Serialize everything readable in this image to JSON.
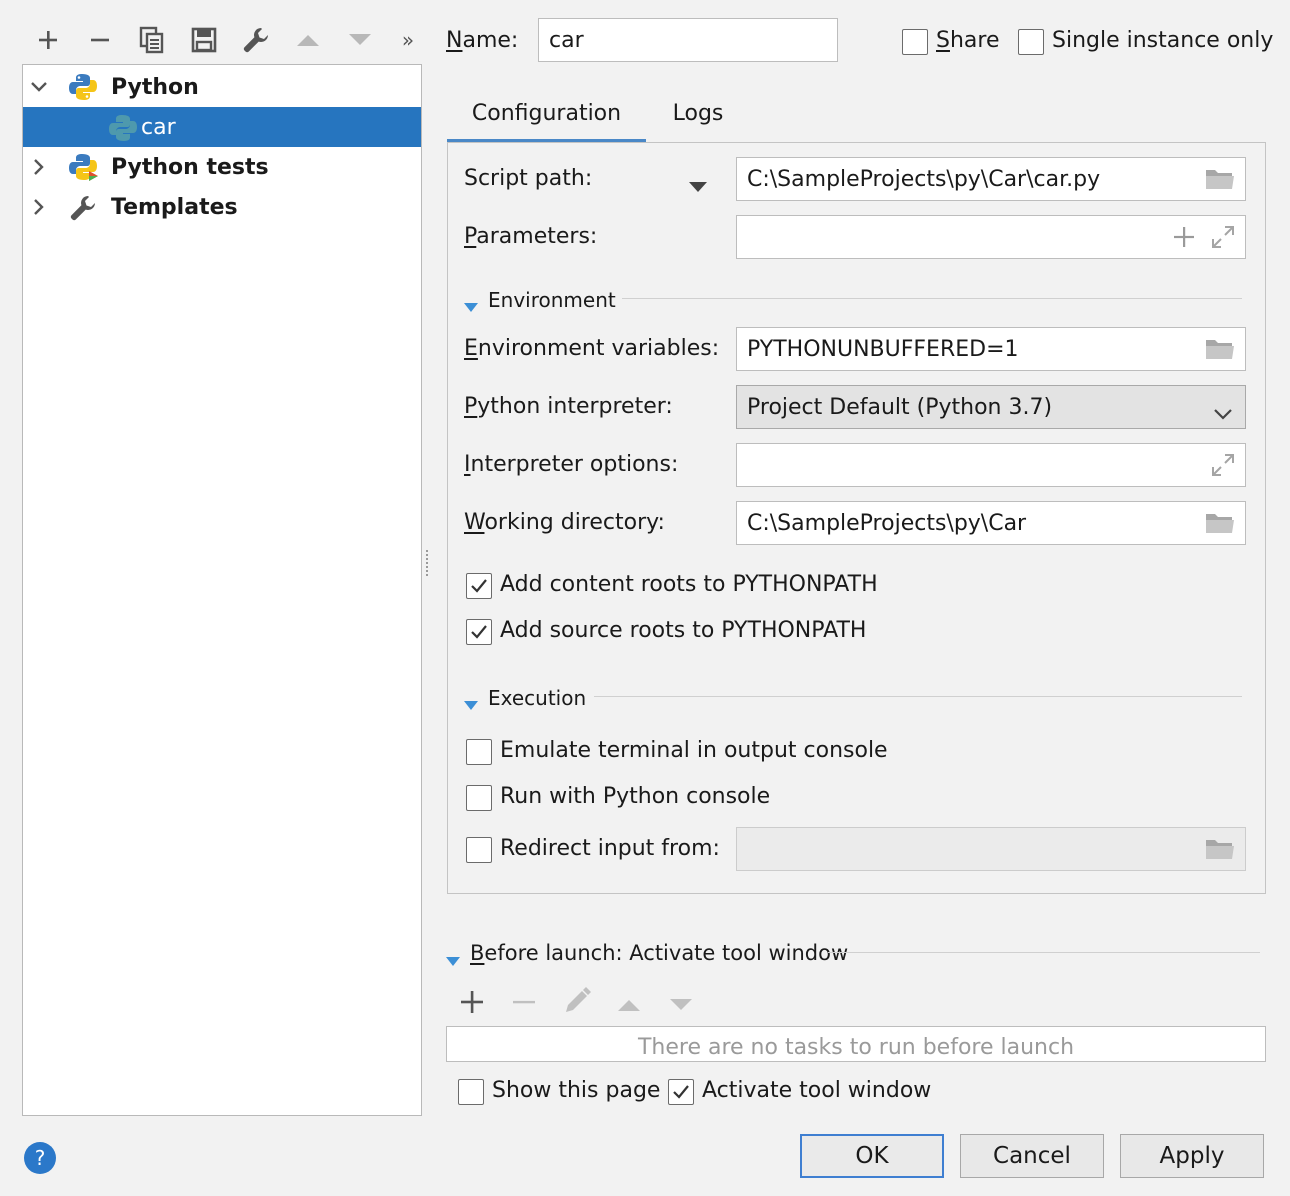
{
  "toolbar": {
    "buttons": [
      {
        "icon": "plus-icon"
      },
      {
        "icon": "minus-icon"
      },
      {
        "icon": "copy-icon"
      },
      {
        "icon": "save-icon"
      },
      {
        "icon": "wrench-icon"
      },
      {
        "icon": "arrow-up-icon"
      },
      {
        "icon": "arrow-down-icon"
      },
      {
        "icon": "more-icon",
        "label": "»"
      }
    ]
  },
  "tree": {
    "items": [
      {
        "label": "Python",
        "icon": "python-icon",
        "expanded": true
      },
      {
        "label": "car",
        "icon": "python-file-icon",
        "selected": true
      },
      {
        "label": "Python tests",
        "icon": "python-tests-icon",
        "expanded": false
      },
      {
        "label": "Templates",
        "icon": "wrench-icon",
        "expanded": false
      }
    ]
  },
  "header": {
    "name_label": "Name:",
    "name_value": "car",
    "share_label": "Share",
    "single_instance_label": "Single instance only"
  },
  "tabs": [
    {
      "label": "Configuration",
      "active": true
    },
    {
      "label": "Logs",
      "active": false
    }
  ],
  "config": {
    "script_path_label": "Script path:",
    "script_path_value": "C:\\SampleProjects\\py\\Car\\car.py",
    "parameters_label": "Parameters:",
    "parameters_value": "",
    "environment_section": "Environment",
    "env_vars_label": "Environment variables:",
    "env_vars_value": "PYTHONUNBUFFERED=1",
    "interpreter_label": "Python interpreter:",
    "interpreter_value": "Project Default (Python 3.7)",
    "interp_options_label": "Interpreter options:",
    "interp_options_value": "",
    "working_dir_label": "Working directory:",
    "working_dir_value": "C:\\SampleProjects\\py\\Car",
    "add_content_roots_label": "Add content roots to PYTHONPATH",
    "add_content_roots_checked": true,
    "add_source_roots_label": "Add source roots to PYTHONPATH",
    "add_source_roots_checked": true,
    "execution_section": "Execution",
    "emulate_terminal_label": "Emulate terminal in output console",
    "emulate_terminal_checked": false,
    "run_python_console_label": "Run with Python console",
    "run_python_console_checked": false,
    "redirect_input_label": "Redirect input from:",
    "redirect_input_checked": false,
    "redirect_input_value": ""
  },
  "before_launch": {
    "title": "Before launch: Activate tool window",
    "empty_text": "There are no tasks to run before launch",
    "show_page_label": "Show this page",
    "show_page_checked": false,
    "activate_tool_label": "Activate tool window",
    "activate_tool_checked": true
  },
  "buttons": {
    "help": "?",
    "ok": "OK",
    "cancel": "Cancel",
    "apply": "Apply"
  },
  "colors": {
    "selection": "#2675bf",
    "accent_tab": "#4a88c7",
    "triangle": "#3c8fd6"
  }
}
